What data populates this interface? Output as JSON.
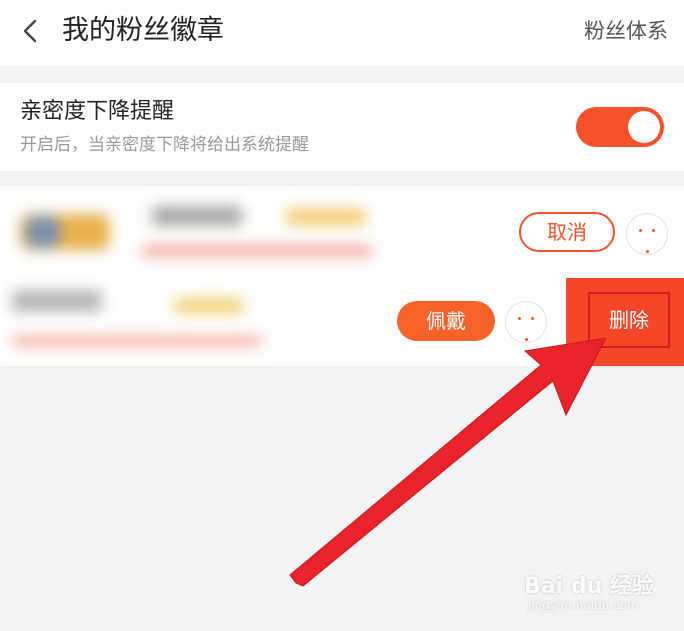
{
  "header": {
    "title": "我的粉丝徽章",
    "right_link": "粉丝体系",
    "back_icon": "chevron-left-icon"
  },
  "settings": {
    "intimacy_alert": {
      "title": "亲密度下降提醒",
      "description": "开启后，当亲密度下降将给出系统提醒",
      "enabled": true
    }
  },
  "badges": {
    "row1": {
      "action_label": "取消",
      "more_icon": "more-icon"
    },
    "row2": {
      "action_label": "佩戴",
      "more_icon": "more-icon"
    },
    "swipe_action": {
      "delete_label": "删除"
    }
  },
  "colors": {
    "accent": "#f5522a",
    "delete_bg": "#f6472b",
    "annotation": "#e8232a"
  },
  "watermark": {
    "text": "Bai du 经验",
    "url": "jingyan.baidu.com"
  }
}
